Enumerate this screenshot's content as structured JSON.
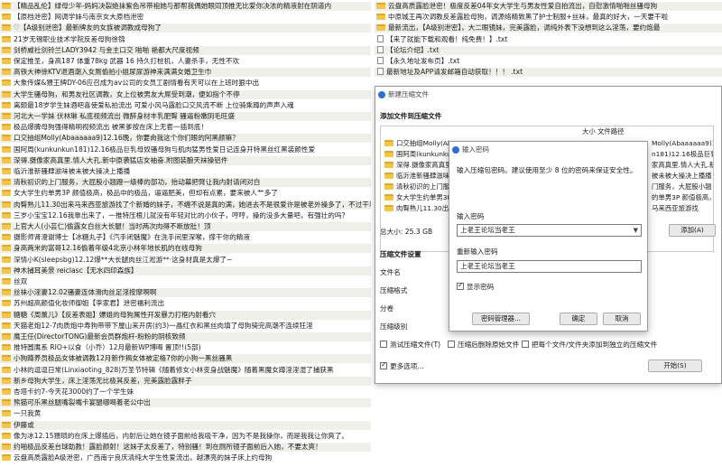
{
  "left_list": [
    "【精品乱伦】绿母少年-妈妈决裂绝抹紫色吊带袍她与那帮我偶她眼同顶推无比爱你决浓的精液射在阴道内",
    "【原档泄密】网调学妹与南京女大原档泄密",
    "♡【A级别泄密】最新牌友的女族被调教成母狗了",
    "21岁无锡职业技术学院反差母狗徐锦",
    "剑桥威社剑铃兰LADY3942 与金主口交 啪啪 艳都大尺度视频",
    "保定推圣，身高187 体重78kg 武器 16 持久打桩机，人妻杀手，无性不欢",
    "高铁大神徐KTV退酒潮入女厕偷拍小姐尿尿游神来满满女婚卫生巾",
    "大象传媒&猥王牌DY-06应召成为av公司的女员工剧情看有天可以在上班时狠中出",
    "大学生骚母狗，和男友社区调教，女上位被男友大屌受到潮，便如指个不停",
    "离颇最18岁学生妹酒吧喜使爱私拍流出 可爱小风马露脸口交风流不断 上位骑乘蹲的声声入魂",
    "河北大一学妹 伏林琳 私底视频流出 微醉身材丰乳肥臀 骚逼粉嫩阴毛旺盛",
    "极品爆脾母狗强得精明视频流出 被黑爹按在床上无套一插到底！",
    "口交抽组Molly(Abaaaaaa9)12.16晚，你要肏我这个你们眼的阿黑颜嘛？",
    "国阿周(kunkunkun181)12.16极品巨乳母奴骚母狗与肌肉猛男性爱日记连身开特黑丝红黑装颜性爱",
    "深得.摄像家高真里.情人大孔.新中原袭猛店女袖奋.附图装酿天袜操铝件",
    "临沂淮新骚肆滋味被未被大操决上播播",
    "清秋初识的上门服务，大屁股小翘蹬一级棒的部功，抬动幕把臂让我内射请闭对白",
    "女大学生约单男3P 颜值极高，极品中的极品，逼逼肥美，但却有点累，要来被人艹多了",
    "肉臀熟儿11.30出来马来西亚旅游找了个新婚的妹子，不缠不说是真的满，她进去不是很爱许是被老外操多了，不过干着很爽",
    "三岁小宝宝12.16我靠出来了，一推特压根儿就没有年轻对比的小伙子，哼哼，操的没多大量吧，有强壮的吗？",
    "上官大人(小芸仁)偷露女白丝大长腿！当时两次肉得不断放肚！顶",
    "摄影师肾澄谢博士【冰糖丸子】《汽手闭魅魔》在洗手间里深喉，撑干你的精液",
    "身高两米的富哥12.16偷着年级4北京小林年地长肌的在线母狗",
    "深情小K(sleepsbg)12.12爆**大长腿肉丝江淞游**·这身材真是太爆了~",
    "神木捕耳美景 reiclasc【无水四印森族】",
    "丝双",
    "丝袜小淫妻12.02骚妻连体滑肉丝足淫按摩啊啊",
    "苏州超高颜值化妆师御姐【李家君】泄密福利流出",
    "糖糖《周薰儿》【反差表姐】嫖姐的母狗属性开发暴力打框内射看穴",
    "天猫老炮12-7肉质炮中寿狗带带下屋山来开房(约3)一晶红衣和黑丝肉填了母狗骑完高潮不连续狂淫",
    "鹰王任(DirectorTONG)最新会员群炮杆-粉粉的阴核致频",
    "推特圆鹰系 RIO+以食（小乔）12月最新WP博喝 置顶!!(5部)",
    "小狗蹲养员极品女体被调教12月新作揭女体被定格7你的小狗一黑丝骚黑",
    "小林的逗逗日常(Linxiaoting_828)万圣节特辑《随着修女小林变身战魅魔》随着黑魔女蹲淫淫湿了捕获黑",
    "新乡母狗大学生，床上淫荡无比极其反差，完美露脸露胖子",
    "杏塔卡约7-今天花3000约了一个学生妹",
    "熊猫可乐黑丝腿嘴裂嘴卡宴腿哪喝着老公中出",
    "一只我黄",
    "伊藤或",
    "像为冰12.15猥琐的在床上爆插后，内射后让她在镜子面前给我吸干净，因为不是我操你，而是我我让你爽了。",
    "约啪极品反差台球助教！露脸颜射！这妹子太反差了，特别骚！到在厕所镜子面前后入她，不要太爽！",
    "云盘高质露脸A级泄密，广西南宁良庆清纯大学生性爱流出，越漂亮的妹子床上约母狗"
  ],
  "right_list": [
    "云盘高质露脸泄密！极度反差04年女大学生与男友性爱自拍流出，自慰激情啪啪丝骚母狗",
    "中原城王再次调教反差露脸母狗，调源络精致黑了护士制服+丝袜，最真的好大，一天要干啦",
    "最新流出，【A级别泄密】，大二眼镜妹，完美露脸，调纯外表下没想到这么淫荡，要约炮最",
    "【来了就能下载和观看！纯免费！】.txt",
    "【论坛介绍】.txt",
    "【永久地址发布页】.txt",
    "最新地址及APP请发邮箱自动获取！！！ .txt"
  ],
  "archive_dialog": {
    "title": "新建压缩文件",
    "add_section": "添加文件到压缩文件",
    "col_size": "大小",
    "col_path": "文件路径",
    "files": [
      "口交抽组Molly(Abaaaaa",
      "国阿周(kunkunkun181",
      "深得.摄像家高真里.情",
      "临沂淮新骚肆滋味被未",
      "清秋初识的上门服务，",
      "女大学生约单男3P 颜",
      "肉臀熟儿11.30出来马"
    ],
    "file_paths": [
      "Molly(Abaaaaaa9)12.16",
      "n181)12.16极品巨乳母",
      "家高真里.情人大孔.新中",
      "被未被大操决上播播",
      "门服务，大屁股小翘",
      "的单男3P 颜值极高，极品",
      "马来西亚旅游找"
    ],
    "total_size": "总大小: 25.3 GB",
    "add_button": "添加(A)",
    "settings_section": "压缩文件设置",
    "filename_label": "文件名",
    "format_label": "压缩格式",
    "split_label": "分卷",
    "level_label": "压缩级别",
    "opt_test": "测试压缩文件(T)",
    "opt_delete": "压缩后删除原始文件",
    "opt_each": "把每个文件/文件夹添加到独立的压缩文件",
    "more_options": "更多选项...",
    "start_button": "开始(S)"
  },
  "password_dialog": {
    "title": "输入密码",
    "hint": "输入压缩包密码。建议使用至少 8 位的密码来保证安全性。",
    "enter_label": "输入密码",
    "password_value": "上老王论坛当老王",
    "reenter_label": "重新输入密码",
    "reenter_value": "上老王论坛当老王",
    "show_password": "显示密码",
    "manager_button": "密码管理器...",
    "ok_button": "确定",
    "cancel_button": "取消"
  }
}
